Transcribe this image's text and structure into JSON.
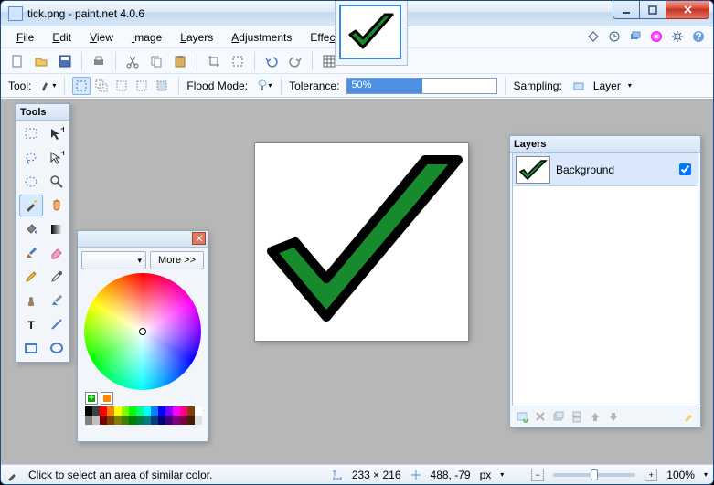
{
  "window": {
    "title": "tick.png - paint.net 4.0.6"
  },
  "menus": {
    "file": "File",
    "edit": "Edit",
    "view": "View",
    "image": "Image",
    "layers": "Layers",
    "adjustments": "Adjustments",
    "effects": "Effects"
  },
  "optbar": {
    "tool_label": "Tool:",
    "flood_label": "Flood Mode:",
    "tolerance_label": "Tolerance:",
    "tolerance_value": "50%",
    "sampling_label": "Sampling:",
    "sampling_value": "Layer"
  },
  "tools_panel": {
    "title": "Tools"
  },
  "colors_panel": {
    "more": "More >>"
  },
  "layers_panel": {
    "title": "Layers",
    "items": [
      {
        "name": "Background",
        "visible": true
      }
    ]
  },
  "status": {
    "hint": "Click to select an area of similar color.",
    "size": "233 × 216",
    "pos": "488, -79",
    "units": "px",
    "zoom": "100%"
  },
  "swatches_row1": [
    "#000",
    "#404040",
    "#ff0000",
    "#ff7f00",
    "#ffff00",
    "#80ff00",
    "#00ff00",
    "#00ff80",
    "#00ffff",
    "#0080ff",
    "#0000ff",
    "#8000ff",
    "#ff00ff",
    "#ff0080",
    "#804000",
    "#ffffff"
  ],
  "swatches_row2": [
    "#808080",
    "#c0c0c0",
    "#800000",
    "#804000",
    "#808000",
    "#408000",
    "#008000",
    "#008040",
    "#008080",
    "#004080",
    "#000080",
    "#400080",
    "#800080",
    "#800040",
    "#402000",
    "#e0e0e0"
  ]
}
